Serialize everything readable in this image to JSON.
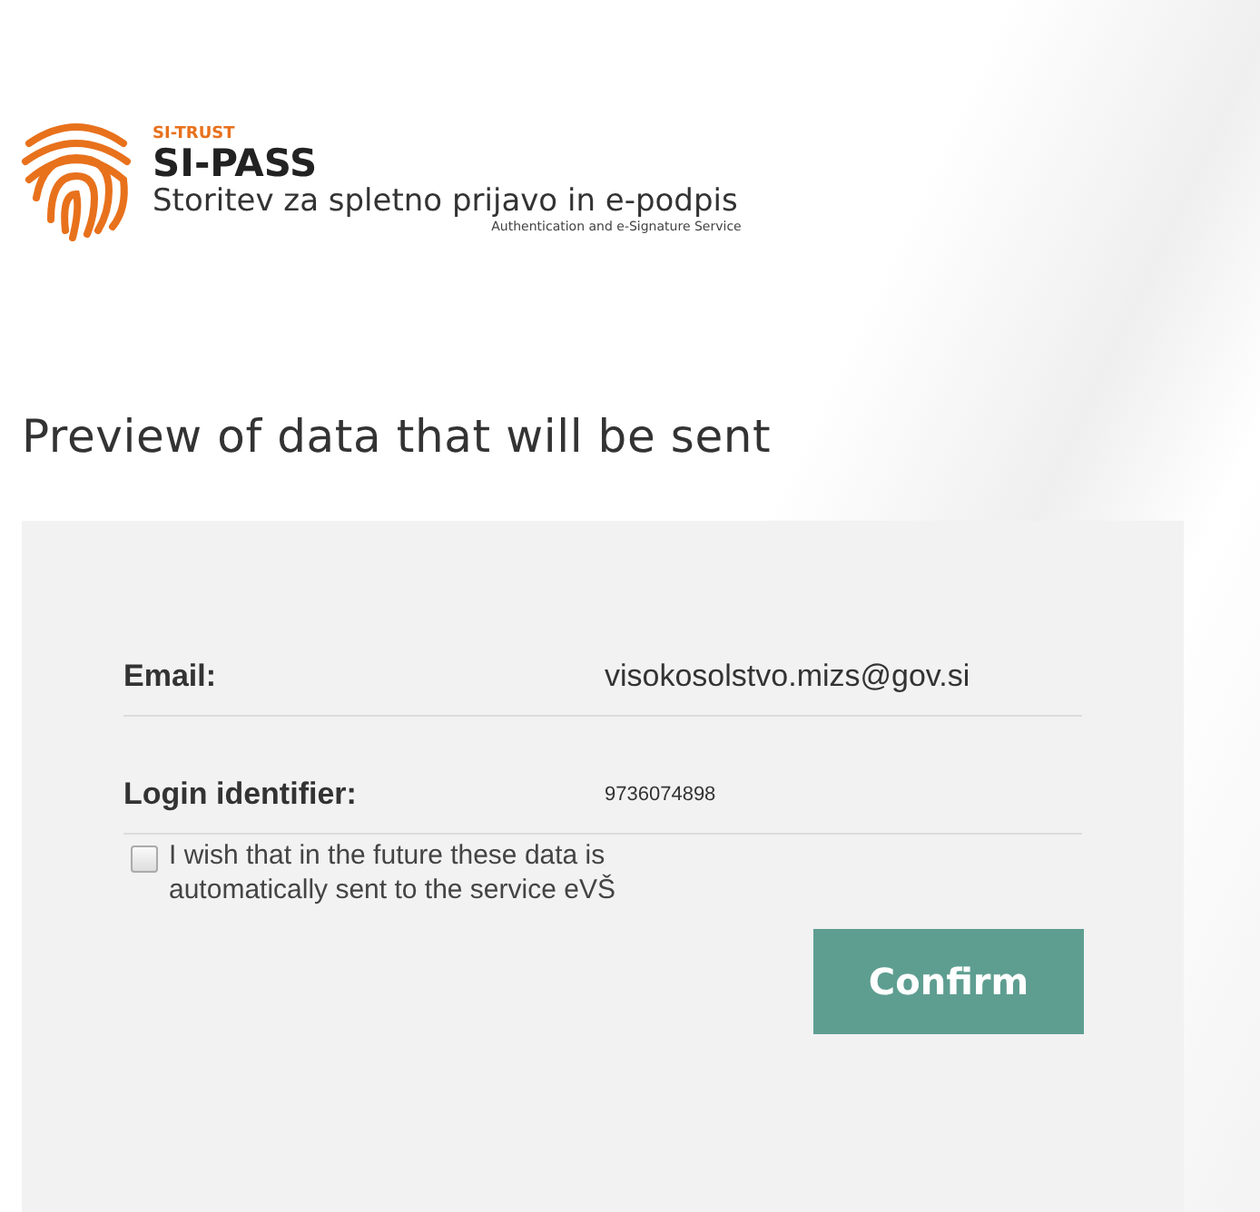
{
  "logo": {
    "brand": "SI-TRUST",
    "name": "SI-PASS",
    "tagline": "Storitev za spletno prijavo in e-podpis",
    "subtitle": "Authentication and e-Signature Service"
  },
  "heading": "Preview of data that will be sent",
  "fields": [
    {
      "kind": "email",
      "label": "Email:",
      "value": "visokosolstvo.mizs@gov.si"
    },
    {
      "kind": "identifier",
      "label": "Login identifier:",
      "value": "9736074898"
    }
  ],
  "consent": {
    "label": "I wish that in the future these data is automatically sent to the service eVŠ",
    "checked": false
  },
  "button": "Confirm"
}
